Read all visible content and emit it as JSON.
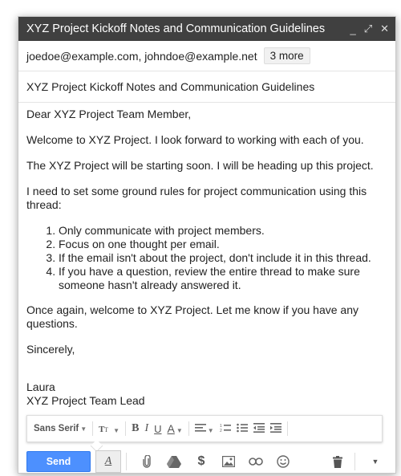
{
  "window": {
    "title": "XYZ Project Kickoff Notes and Communication Guidelines",
    "minimize": "_",
    "expand": "⤢",
    "close": "✕"
  },
  "recipients": {
    "text": "joedoe@example.com, johndoe@example.net",
    "more_label": "3 more"
  },
  "subject": "XYZ Project Kickoff Notes and Communication Guidelines",
  "body": {
    "greeting": "Dear XYZ Project Team Member,",
    "p1": "Welcome to XYZ Project. I look forward to working with each of you.",
    "p2": "The XYZ Project will be starting soon. I will be heading up this project.",
    "p3": "I need to set some ground rules for project communication using this thread:",
    "rules": [
      "Only communicate with project members.",
      "Focus on one thought per email.",
      "If the email isn't about the project, don't include it in this thread.",
      "If you have a question, review the entire thread to make sure someone hasn't already answered it."
    ],
    "p4": "Once again, welcome to XYZ Project. Let me know if you have any questions.",
    "closing": "Sincerely,",
    "sig_name": "Laura",
    "sig_title": "XYZ Project Team Lead"
  },
  "format_toolbar": {
    "font": "Sans Serif",
    "size_icon": "size-icon",
    "bold": "B",
    "italic": "I",
    "underline": "U",
    "text_color": "A",
    "align_icon": "align-icon",
    "numbered_list_icon": "numbered-list-icon",
    "bulleted_list_icon": "bulleted-list-icon",
    "indent_less_icon": "indent-less-icon",
    "indent_more_icon": "indent-more-icon"
  },
  "bottom_toolbar": {
    "send_label": "Send",
    "format_label": "A",
    "icons": [
      "attach-icon",
      "drive-icon",
      "money-icon",
      "photo-icon",
      "link-icon",
      "emoji-icon",
      "trash-icon",
      "more-options-icon"
    ]
  },
  "colors": {
    "titlebar": "#404040",
    "send": "#4d90fe"
  }
}
